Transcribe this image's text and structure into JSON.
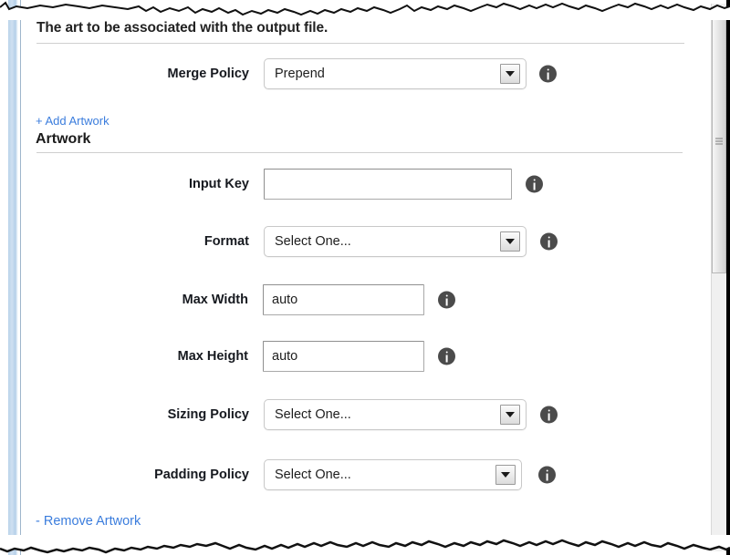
{
  "section": {
    "title": "The art to be associated with the output file.",
    "subsection_title": "Artwork"
  },
  "links": {
    "add_artwork": "+ Add Artwork",
    "remove_artwork": "- Remove Artwork"
  },
  "icons": {
    "info": "info-icon",
    "dropdown_arrow": "chevron-down-icon",
    "scrollbar_grip": "scrollbar-grip-icon"
  },
  "fields": [
    {
      "name": "merge-policy",
      "label": "Merge Policy",
      "control": "select",
      "value": "Prepend",
      "info": "info-icon"
    },
    {
      "name": "input-key",
      "label": "Input Key",
      "control": "text",
      "value": "",
      "placeholder": "",
      "info": "info-icon"
    },
    {
      "name": "format",
      "label": "Format",
      "control": "select",
      "value": "Select One...",
      "info": "info-icon"
    },
    {
      "name": "max-width",
      "label": "Max Width",
      "control": "text",
      "value": "auto",
      "placeholder": "auto",
      "info": "info-icon"
    },
    {
      "name": "max-height",
      "label": "Max Height",
      "control": "text",
      "value": "auto",
      "placeholder": "auto",
      "info": "info-icon"
    },
    {
      "name": "sizing-policy",
      "label": "Sizing Policy",
      "control": "select",
      "value": "Select One...",
      "info": "info-icon"
    },
    {
      "name": "padding-policy",
      "label": "Padding Policy",
      "control": "select",
      "value": "Select One...",
      "info": "info-icon"
    }
  ],
  "colors": {
    "link": "#3b7ddd",
    "label_text": "#16191f",
    "info_icon_fill": "#4b4b4b",
    "rule": "#cfcfcf",
    "field_border": "#c8c8c8",
    "gutter_blue": "#b9d3ea"
  }
}
